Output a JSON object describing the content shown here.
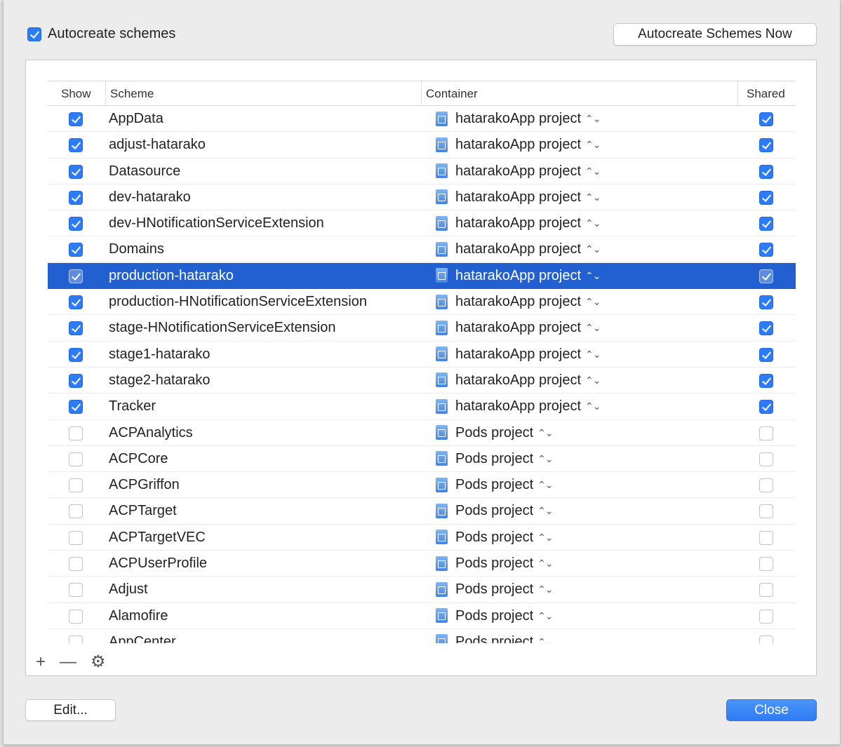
{
  "header": {
    "autocreate_label": "Autocreate schemes",
    "autocreate_checked": true,
    "autocreate_now_label": "Autocreate Schemes Now"
  },
  "table": {
    "columns": {
      "show": "Show",
      "scheme": "Scheme",
      "container": "Container",
      "shared": "Shared"
    },
    "selected_index": 6,
    "rows": [
      {
        "show": true,
        "scheme": "AppData",
        "container": "hatarakoApp project",
        "shared": true
      },
      {
        "show": true,
        "scheme": "adjust-hatarako",
        "container": "hatarakoApp project",
        "shared": true
      },
      {
        "show": true,
        "scheme": "Datasource",
        "container": "hatarakoApp project",
        "shared": true
      },
      {
        "show": true,
        "scheme": "dev-hatarako",
        "container": "hatarakoApp project",
        "shared": true
      },
      {
        "show": true,
        "scheme": "dev-HNotificationServiceExtension",
        "container": "hatarakoApp project",
        "shared": true
      },
      {
        "show": true,
        "scheme": "Domains",
        "container": "hatarakoApp project",
        "shared": true
      },
      {
        "show": true,
        "scheme": "production-hatarako",
        "container": "hatarakoApp project",
        "shared": true
      },
      {
        "show": true,
        "scheme": "production-HNotificationServiceExtension",
        "container": "hatarakoApp project",
        "shared": true
      },
      {
        "show": true,
        "scheme": "stage-HNotificationServiceExtension",
        "container": "hatarakoApp project",
        "shared": true
      },
      {
        "show": true,
        "scheme": "stage1-hatarako",
        "container": "hatarakoApp project",
        "shared": true
      },
      {
        "show": true,
        "scheme": "stage2-hatarako",
        "container": "hatarakoApp project",
        "shared": true
      },
      {
        "show": true,
        "scheme": "Tracker",
        "container": "hatarakoApp project",
        "shared": true
      },
      {
        "show": false,
        "scheme": "ACPAnalytics",
        "container": "Pods project",
        "shared": false
      },
      {
        "show": false,
        "scheme": "ACPCore",
        "container": "Pods project",
        "shared": false
      },
      {
        "show": false,
        "scheme": "ACPGriffon",
        "container": "Pods project",
        "shared": false
      },
      {
        "show": false,
        "scheme": "ACPTarget",
        "container": "Pods project",
        "shared": false
      },
      {
        "show": false,
        "scheme": "ACPTargetVEC",
        "container": "Pods project",
        "shared": false
      },
      {
        "show": false,
        "scheme": "ACPUserProfile",
        "container": "Pods project",
        "shared": false
      },
      {
        "show": false,
        "scheme": "Adjust",
        "container": "Pods project",
        "shared": false
      },
      {
        "show": false,
        "scheme": "Alamofire",
        "container": "Pods project",
        "shared": false
      },
      {
        "show": false,
        "scheme": "AppCenter",
        "container": "Pods project",
        "shared": false
      }
    ]
  },
  "toolbar": {
    "add": "+",
    "remove": "—",
    "settings": "⚙"
  },
  "footer": {
    "edit_label": "Edit...",
    "close_label": "Close"
  },
  "icons": {
    "checkbox": "checkbox-icon",
    "project": "xcode-project-icon",
    "popup": "up-down-chevron-icon"
  },
  "colors": {
    "accent": "#2d7cf6",
    "selection": "#2260d1"
  }
}
